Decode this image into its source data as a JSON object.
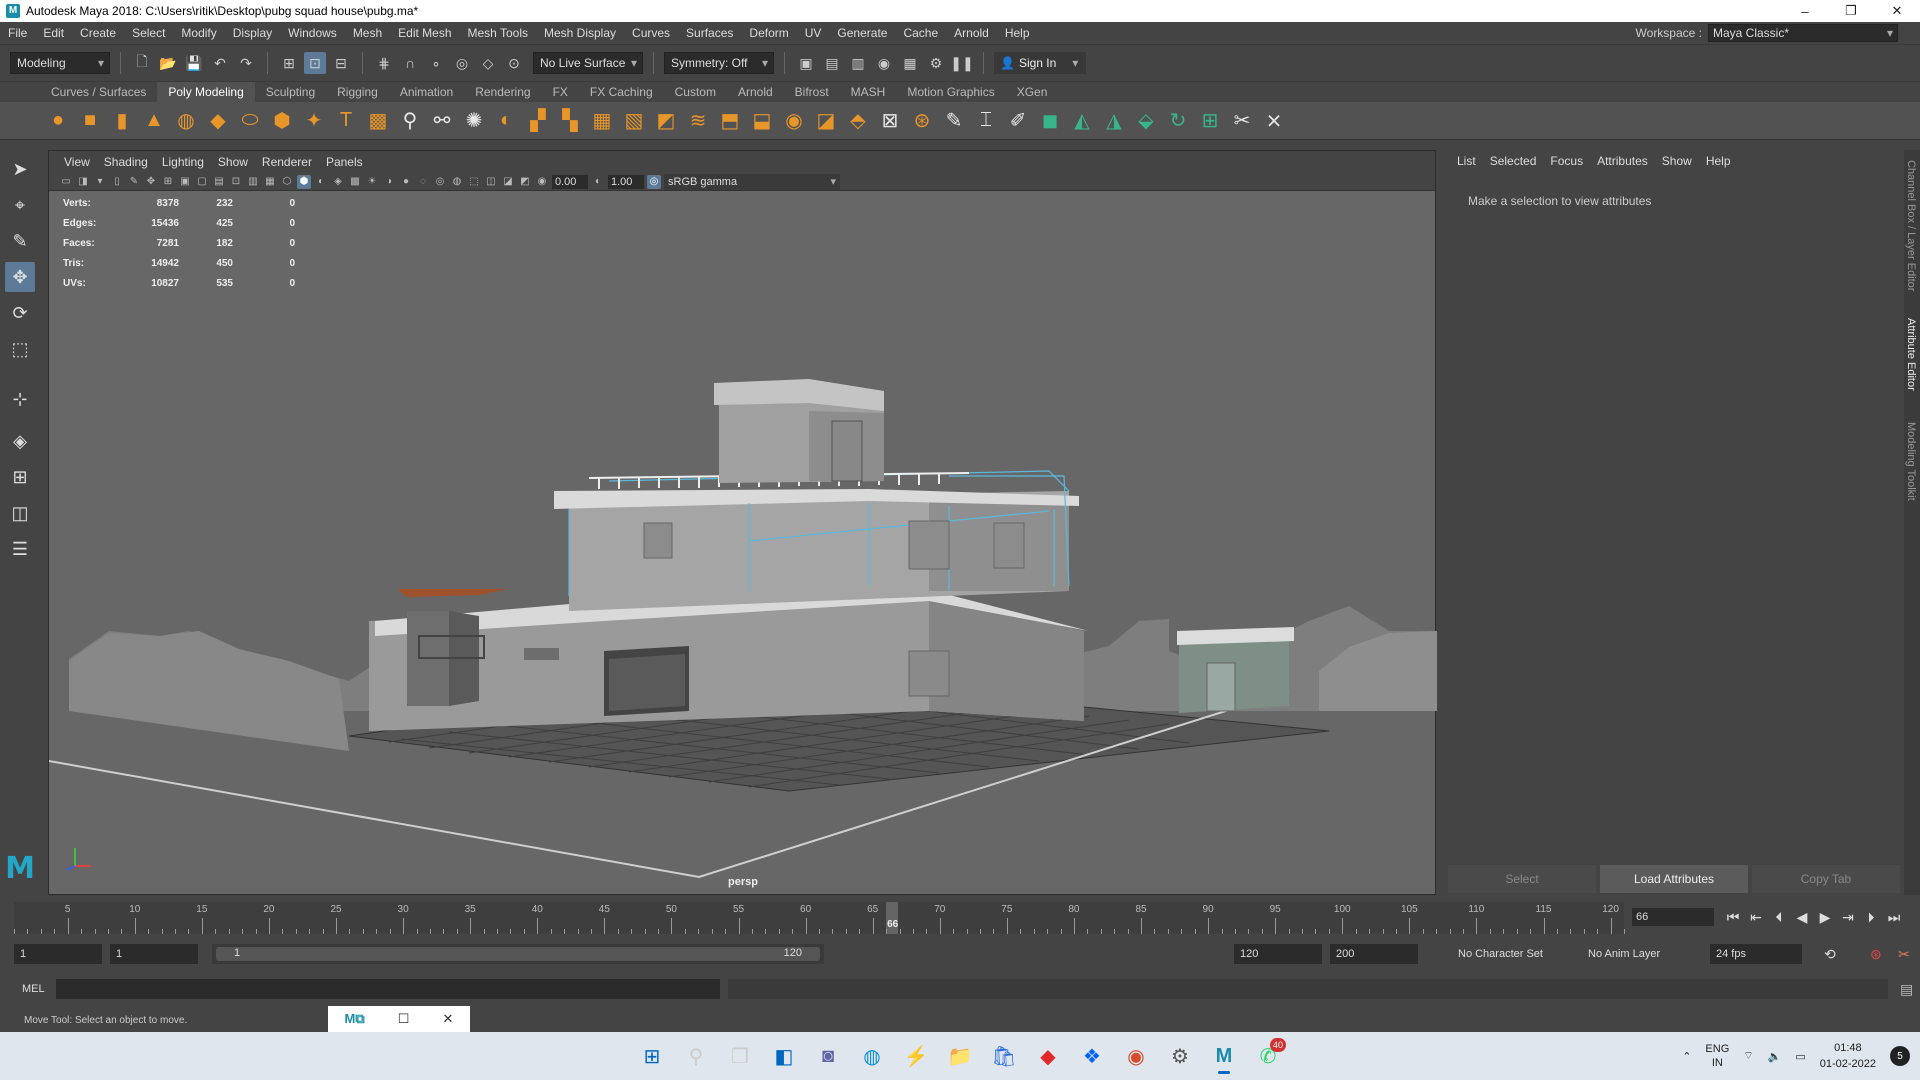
{
  "window": {
    "title": "Autodesk Maya 2018: C:\\Users\\ritik\\Desktop\\pubg squad house\\pubg.ma*",
    "icon": "maya-icon",
    "controls": [
      "–",
      "❐",
      "✕"
    ]
  },
  "menubar": {
    "items": [
      "File",
      "Edit",
      "Create",
      "Select",
      "Modify",
      "Display",
      "Windows",
      "Mesh",
      "Edit Mesh",
      "Mesh Tools",
      "Mesh Display",
      "Curves",
      "Surfaces",
      "Deform",
      "UV",
      "Generate",
      "Cache",
      "Arnold",
      "Help"
    ],
    "workspace_label": "Workspace :",
    "workspace_value": "Maya Classic*"
  },
  "statusline": {
    "menuset": "Modeling",
    "live_surface": "No Live Surface",
    "symmetry": "Symmetry: Off",
    "sign_in": "Sign In"
  },
  "shelf": {
    "tabs": [
      "Curves / Surfaces",
      "Poly Modeling",
      "Sculpting",
      "Rigging",
      "Animation",
      "Rendering",
      "FX",
      "FX Caching",
      "Custom",
      "Arnold",
      "Bifrost",
      "MASH",
      "Motion Graphics",
      "XGen"
    ],
    "active_tab": "Poly Modeling"
  },
  "viewport": {
    "menu": [
      "View",
      "Shading",
      "Lighting",
      "Show",
      "Renderer",
      "Panels"
    ],
    "exposure": "0.00",
    "gamma": "1.00",
    "color_space": "sRGB gamma",
    "camera": "persp",
    "hud": [
      {
        "label": "Verts:",
        "a": "8378",
        "b": "232",
        "c": "0"
      },
      {
        "label": "Edges:",
        "a": "15436",
        "b": "425",
        "c": "0"
      },
      {
        "label": "Faces:",
        "a": "7281",
        "b": "182",
        "c": "0"
      },
      {
        "label": "Tris:",
        "a": "14942",
        "b": "450",
        "c": "0"
      },
      {
        "label": "UVs:",
        "a": "10827",
        "b": "535",
        "c": "0"
      }
    ]
  },
  "attribute_editor": {
    "menu": [
      "List",
      "Selected",
      "Focus",
      "Attributes",
      "Show",
      "Help"
    ],
    "message": "Make a selection to view attributes",
    "buttons": [
      "Select",
      "Load Attributes",
      "Copy Tab"
    ],
    "side_tabs": [
      "Channel Box / Layer Editor",
      "Attribute Editor",
      "Modeling Toolkit"
    ]
  },
  "timeline": {
    "ticks": [
      "5",
      "10",
      "15",
      "20",
      "25",
      "30",
      "35",
      "40",
      "45",
      "50",
      "55",
      "60",
      "65",
      "70",
      "75",
      "80",
      "85",
      "90",
      "95",
      "100",
      "105",
      "110",
      "115",
      "120"
    ],
    "current_frame": "66",
    "current_time_field": "66",
    "frame_min": 1,
    "frame_max": 121
  },
  "range": {
    "start": "1",
    "playback_start": "1",
    "slider_start": "1",
    "slider_end": "120",
    "playback_end": "120",
    "end": "200",
    "character_set": "No Character Set",
    "anim_layer": "No Anim Layer",
    "fps": "24 fps"
  },
  "mel": {
    "label": "MEL"
  },
  "helpline": {
    "text": "Move Tool: Select an object to move."
  },
  "taskbar": {
    "lang_1": "ENG",
    "lang_2": "IN",
    "time": "01:48",
    "date": "01-02-2022",
    "notifications": "5",
    "whatsapp_badge": "40"
  },
  "colors": {
    "accent": "#5d7b99",
    "shelf_orange": "#e8962a",
    "shelf_green": "#38b58a",
    "maya_blue": "#23a6c8"
  }
}
